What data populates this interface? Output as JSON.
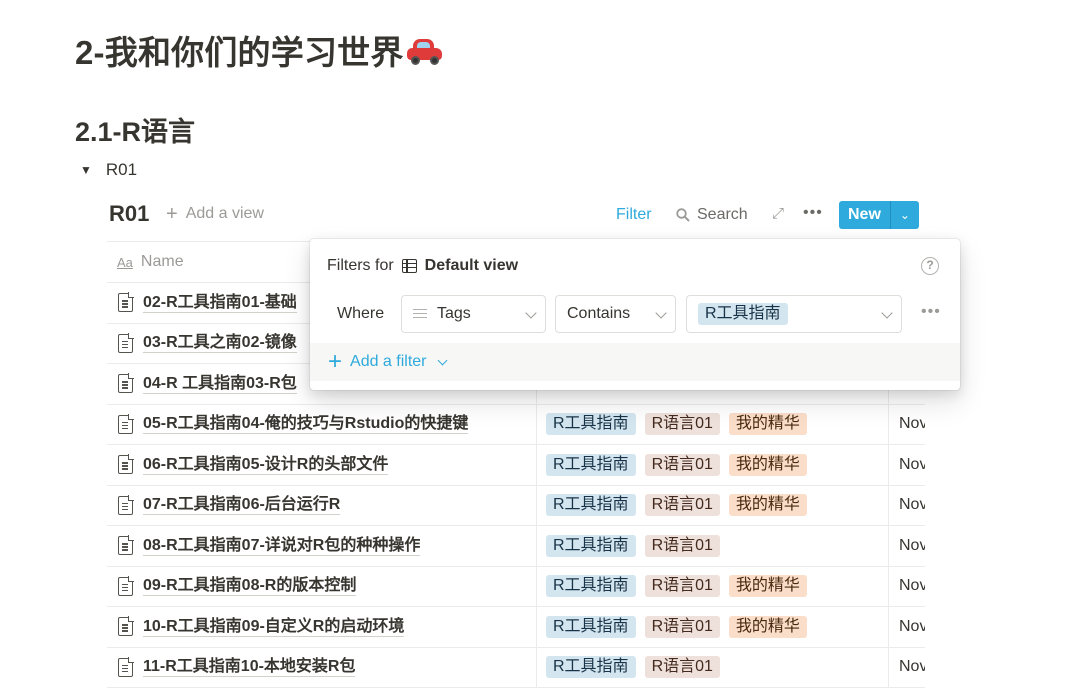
{
  "page": {
    "h1": "2-我和你们的学习世界",
    "h2": "2.1-R语言",
    "toggle_label": "R01"
  },
  "database": {
    "title": "R01",
    "add_view": "Add a view",
    "filter_label": "Filter",
    "search_label": "Search",
    "new_label": "New",
    "name_header": "Name",
    "rows": [
      {
        "name": "02-R工具指南01-基础",
        "tags": [],
        "date": ""
      },
      {
        "name": "03-R工具之南02-镜像",
        "tags": [],
        "date": ""
      },
      {
        "name": "04-R 工具指南03-R包",
        "tags": [],
        "date": ""
      },
      {
        "name": "05-R工具指南04-俺的技巧与Rstudio的快捷键",
        "tags": [
          "R工具指南",
          "R语言01",
          "我的精华"
        ],
        "date": "Nov"
      },
      {
        "name": "06-R工具指南05-设计R的头部文件",
        "tags": [
          "R工具指南",
          "R语言01",
          "我的精华"
        ],
        "date": "Nov"
      },
      {
        "name": "07-R工具指南06-后台运行R",
        "tags": [
          "R工具指南",
          "R语言01",
          "我的精华"
        ],
        "date": "Nov"
      },
      {
        "name": "08-R工具指南07-详说对R包的种种操作",
        "tags": [
          "R工具指南",
          "R语言01"
        ],
        "date": "Nov"
      },
      {
        "name": "09-R工具指南08-R的版本控制",
        "tags": [
          "R工具指南",
          "R语言01",
          "我的精华"
        ],
        "date": "Nov"
      },
      {
        "name": "10-R工具指南09-自定义R的启动环境",
        "tags": [
          "R工具指南",
          "R语言01",
          "我的精华"
        ],
        "date": "Nov"
      },
      {
        "name": "11-R工具指南10-本地安装R包",
        "tags": [
          "R工具指南",
          "R语言01"
        ],
        "date": "Nov"
      }
    ]
  },
  "filter_popup": {
    "title_prefix": "Filters for",
    "view_name": "Default view",
    "where_label": "Where",
    "property": "Tags",
    "operator": "Contains",
    "value": "R工具指南",
    "add_filter": "Add a filter"
  },
  "tag_colors": {
    "R工具指南": "blue",
    "R语言01": "brown",
    "我的精华": "orange"
  }
}
